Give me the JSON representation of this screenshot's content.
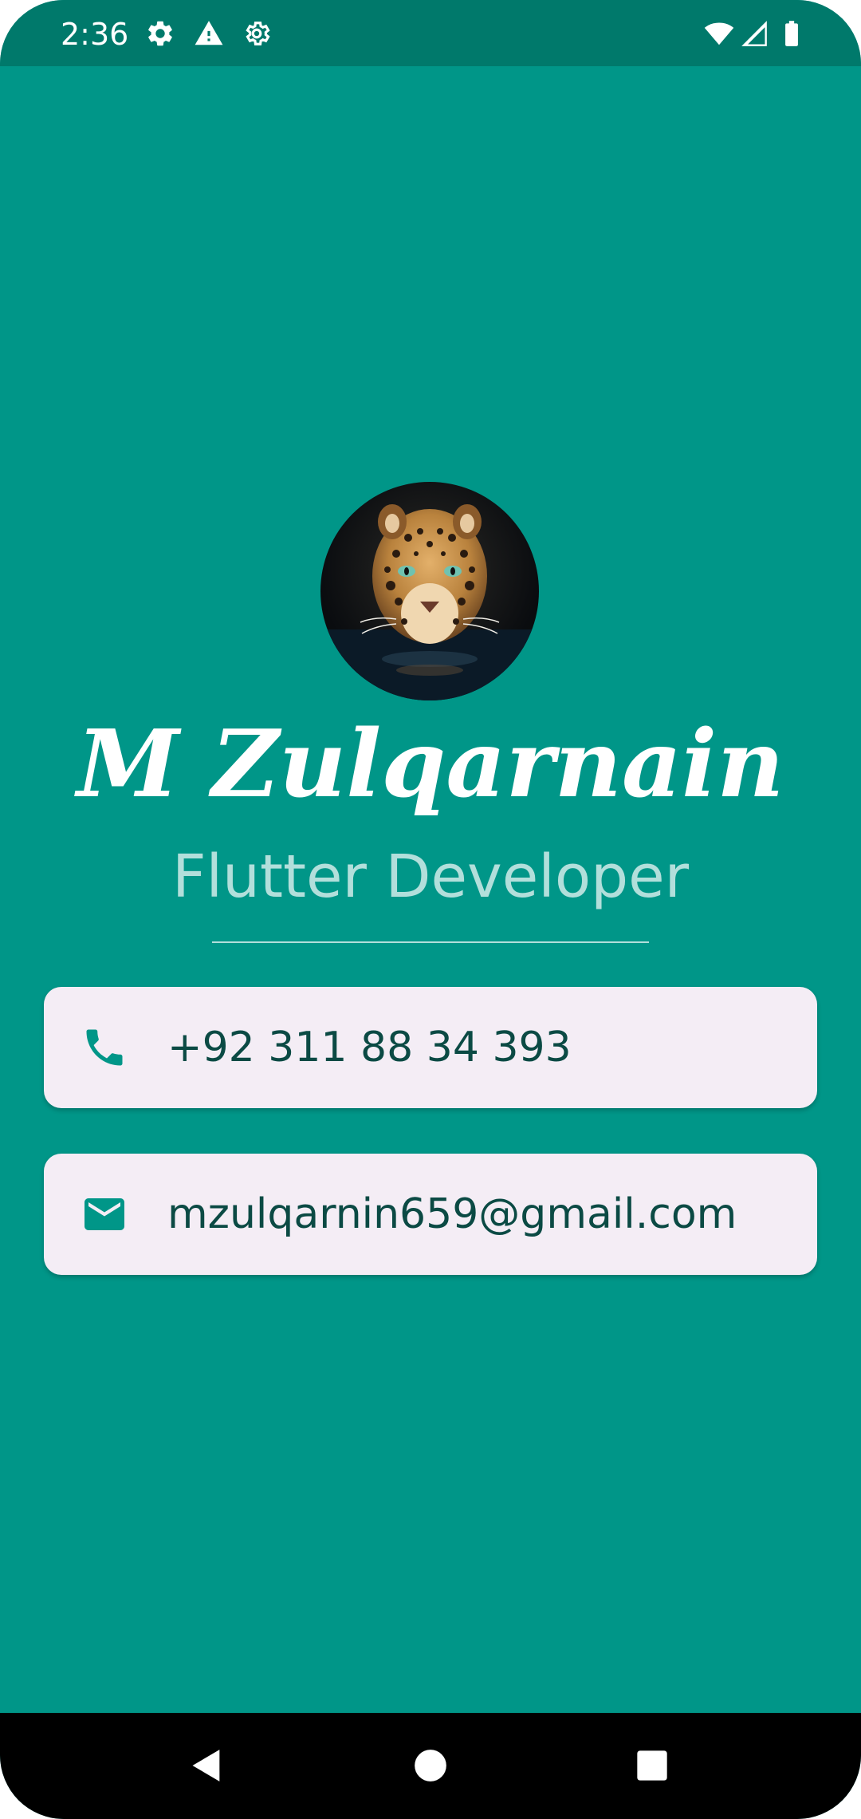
{
  "status_bar": {
    "time": "2:36",
    "left_icons": [
      "settings-icon",
      "warning-icon",
      "settings-outline-icon"
    ],
    "right_icons": [
      "wifi-icon",
      "cell-signal-icon",
      "battery-icon"
    ]
  },
  "profile": {
    "avatar_alt": "leopard-avatar",
    "name": "M Zulqarnain",
    "title": "Flutter Developer"
  },
  "contacts": {
    "phone": {
      "icon": "phone-icon",
      "value": "+92 311 88 34 393"
    },
    "email": {
      "icon": "mail-icon",
      "value": "mzulqarnin659@gmail.com"
    }
  },
  "navigation": {
    "back": "back-icon",
    "home": "home-icon",
    "recents": "recents-icon"
  },
  "colors": {
    "background": "#009688",
    "status_bar": "#00796b",
    "card": "#f4edf5",
    "card_text": "#0b4a44",
    "icon_accent": "#009688",
    "subtitle": "#b2dfdb"
  }
}
